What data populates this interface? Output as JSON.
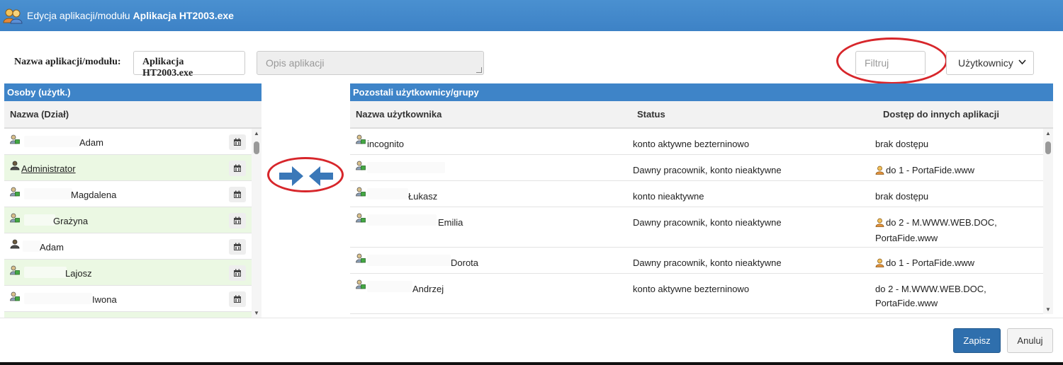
{
  "window": {
    "title_prefix": "Edycja aplikacji/modułu",
    "title_app": "Aplikacja HT2003.exe"
  },
  "form": {
    "name_label": "Nazwa aplikacji/modułu:",
    "name_value": "Aplikacja HT2003.exe",
    "description_placeholder": "Opis aplikacji",
    "filter_placeholder": "Filtruj",
    "type_select_value": "Użytkownicy"
  },
  "left_panel": {
    "title": "Osoby (użytk.)",
    "column": "Nazwa (Dział)",
    "rows": [
      {
        "name": "Adam",
        "link": false
      },
      {
        "name": "Administrator",
        "link": true
      },
      {
        "name": "Magdalena",
        "link": false
      },
      {
        "name": "Grażyna",
        "link": false
      },
      {
        "name": "Adam",
        "link": false
      },
      {
        "name": "Lajosz",
        "link": false
      },
      {
        "name": "Iwona",
        "link": false
      }
    ]
  },
  "right_panel": {
    "title": "Pozostali użytkownicy/grupy",
    "columns": [
      "Nazwa użytkownika",
      "Status",
      "Dostęp do innych aplikacji"
    ],
    "rows": [
      {
        "name": "incognito",
        "status": "konto aktywne bezterninowo",
        "access": "brak dostępu",
        "access_icon": false,
        "access_line2": ""
      },
      {
        "name": "",
        "status": "Dawny pracownik, konto nieaktywne",
        "access": "do 1 - PortaFide.www",
        "access_icon": true,
        "access_line2": ""
      },
      {
        "name": "Łukasz",
        "status": "konto nieaktywne",
        "access": "brak dostępu",
        "access_icon": false,
        "access_line2": ""
      },
      {
        "name": "Emilia",
        "status": "Dawny pracownik, konto nieaktywne",
        "access": "do 2 - M.WWW.WEB.DOC,",
        "access_icon": true,
        "access_line2": "PortaFide.www"
      },
      {
        "name": "Dorota",
        "status": "Dawny pracownik, konto nieaktywne",
        "access": "do 1 - PortaFide.www",
        "access_icon": true,
        "access_line2": ""
      },
      {
        "name": "Andrzej",
        "status": "konto aktywne bezterninowo",
        "access": "do 2 - M.WWW.WEB.DOC,",
        "access_icon": false,
        "access_line2": "PortaFide.www"
      }
    ]
  },
  "footer": {
    "save_label": "Zapisz",
    "cancel_label": "Anuluj"
  },
  "colors": {
    "header_blue": "#3e84c8",
    "row_alt_green": "#ebf8e3",
    "annotation_red": "#d7262b",
    "save_blue": "#2f6fad"
  },
  "icons": {
    "title": "users-icon",
    "row": "user-lock-icon",
    "admin": "admin-user-icon",
    "list_action": "calendar-icon",
    "transfer": "transfer-arrows-icon",
    "access": "person-icon"
  }
}
